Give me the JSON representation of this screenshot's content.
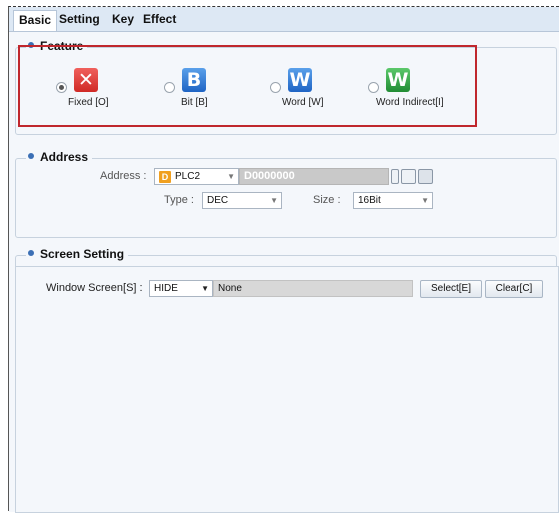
{
  "tabs": [
    "Basic",
    "Setting",
    "Key",
    "Effect"
  ],
  "feature": {
    "title": "Feature",
    "options": [
      {
        "label": "Fixed [O]",
        "glyph": "✕",
        "color": "red",
        "checked": true
      },
      {
        "label": "Bit [B]",
        "glyph": "B",
        "color": "blue",
        "checked": false
      },
      {
        "label": "Word [W]",
        "glyph": "W",
        "color": "blue",
        "checked": false
      },
      {
        "label": "Word Indirect[I]",
        "glyph": "W",
        "color": "green",
        "checked": false
      }
    ]
  },
  "address": {
    "title": "Address",
    "address_label": "Address :",
    "plc_badge": "D",
    "plc_value": "PLC2",
    "device_value": "D0000000",
    "type_label": "Type :",
    "type_value": "DEC",
    "size_label": "Size :",
    "size_value": "16Bit"
  },
  "screen": {
    "title": "Screen Setting",
    "window_label": "Window Screen[S] :",
    "window_value": "HIDE",
    "screen_name": "None",
    "select_label": "Select[E]",
    "clear_label": "Clear[C]"
  },
  "colors": {
    "accent": "#3b6fb5",
    "highlight_border": "#c0272d",
    "tab_bar": "#dde8f4",
    "panel_bg": "#f4f7fb"
  }
}
